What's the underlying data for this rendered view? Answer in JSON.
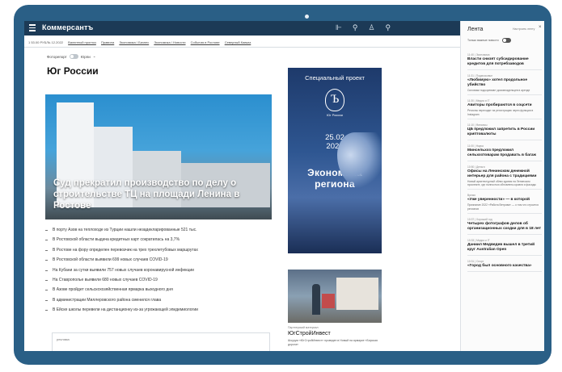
{
  "app": {
    "logo": "Коммерсантъ"
  },
  "topbar": {
    "icons": [
      "share-icon",
      "location-icon",
      "user-icon",
      "search-icon"
    ],
    "glyphs": [
      "⊩",
      "⚲",
      "♙",
      "⚲"
    ]
  },
  "subnav": {
    "date": "1 53.00  РУБЛЬ  12.2022",
    "links": [
      "Валютный прогноз",
      "Правила",
      "Экономика / Бизнес",
      "Экономика / Новости",
      "События в Ростове",
      "Северный Кавказ"
    ]
  },
  "filters": {
    "important_label": "Фоторепорт",
    "region_label": "Юрпи"
  },
  "page": {
    "title": "Юг России"
  },
  "hero": {
    "title": "Суд прекратил производство по делу о строительстве ТЦ на площади Ленина в Ростове"
  },
  "news": [
    "В порту Азов на теплоходе из Турции нашли незадекларированные 521 тыс.",
    "В Ростовской области выдача кредитных карт сократилась на 3,7%",
    "В Ростове на фору определен перевозчик на трех трехлетубовых маршрутах",
    "В Ростовской области выявили 699 новых случаев COVID-19",
    "На Кубани за сутки выявили 757 новых случаев коронавирусной инфекции",
    "На Ставрополье выявили 680 новых случаев COVID-19",
    "В Азове пройдет сельскохозяйственная ярмарка выходного дня",
    "В администрации Миллеровского района сменился глава",
    "В Ейске школы перевели на дистанционку из-за угрожающей эпидемиологии"
  ],
  "more_box": {
    "label": "реклама"
  },
  "promo": {
    "header": "Специальный проект",
    "logo_letter": "Ъ",
    "logo_caption": "Юг России",
    "date_line1": "25.02",
    "date_line2": "2022",
    "title_line1": "Экономика",
    "title_line2": "региона"
  },
  "photo_card": {
    "label": "Партнерский материал",
    "title": "ЮгСтройИнвест",
    "desc": "Шоурум «ЮгСтройИнвест» проведен в Новый на ярмарке «Бирская дорога»"
  },
  "feed": {
    "title": "Лента",
    "settings_label": "Настроить ленту",
    "filter_label": "Только важные новости",
    "items": [
      {
        "meta": "11:40 | Экономика",
        "title": "Власти снизят субсидирование кредитов для потребзаводов",
        "desc": ""
      },
      {
        "meta": "11:31 | Подмосковье",
        "title": "«Любимую» хотел продольное убийство",
        "desc": "Силовики подозревают домовладельцев в аренде"
      },
      {
        "meta": "11:30 | Медиа и IT",
        "title": "Авиторы пробираются в соцсети",
        "desc": "Регионы переходят на регистрацию через функции в Instagram"
      },
      {
        "meta": "11:10 | Финансы",
        "title": "ЦБ предложил запретить в России криптовалюты",
        "desc": ""
      },
      {
        "meta": "11:00 | Наука",
        "title": "Минсельхоз предложил сельхозтоварам продавать в багаж",
        "desc": ""
      },
      {
        "meta": "10:50 | Деньги",
        "title": "Офисы на Ленинском денежной интерьер для района с традициями",
        "desc": "Новый архитектурный облик здания на Ленинском проспекте, где полностью обновлены кровля и фасады"
      },
      {
        "meta": "Время",
        "title": "«Уже уверенности» — в которой",
        "desc": "Признание 2022 «Работа Ветрова» — о том что строится регионов"
      },
      {
        "meta": "10:37 | Хороший год",
        "title": "Четырех фотографов делов об организационных сходки для в 18 лет",
        "desc": ""
      },
      {
        "meta": "10:33 | Медиа и IT",
        "title": "Даниил Медведев вышел в третий круг Australian Open",
        "desc": ""
      },
      {
        "meta": "10:31 | Спорт",
        "title": "«Город был основного качества»",
        "desc": ""
      }
    ]
  }
}
